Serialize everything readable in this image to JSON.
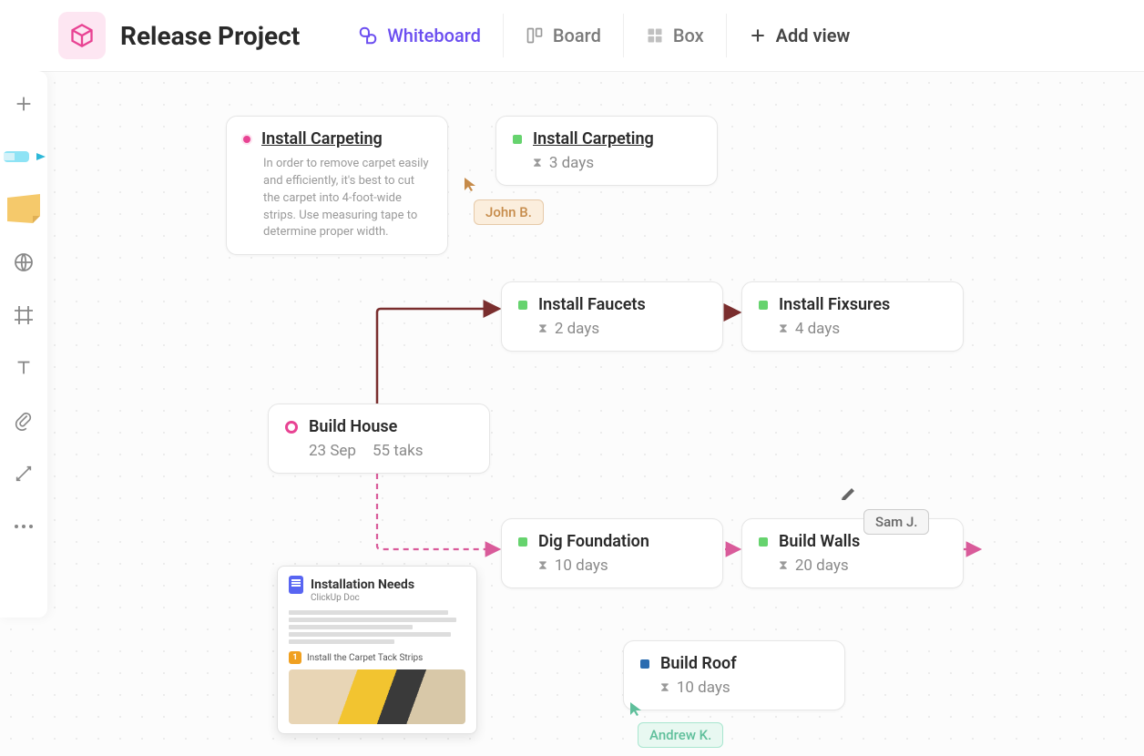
{
  "header": {
    "project_title": "Release Project",
    "tabs": {
      "whiteboard": "Whiteboard",
      "board": "Board",
      "box": "Box",
      "add_view": "Add view"
    }
  },
  "cards": {
    "install_carpeting_note": {
      "title": "Install Carpeting",
      "description": "In order to remove carpet easily and efficiently, it's best to cut the carpet into 4-foot-wide strips. Use measuring tape to determine proper width."
    },
    "install_carpeting_task": {
      "title": "Install Carpeting",
      "duration": "3 days"
    },
    "install_faucets": {
      "title": "Install Faucets",
      "duration": "2 days"
    },
    "install_fixtures": {
      "title": "Install Fixsures",
      "duration": "4 days"
    },
    "build_house": {
      "title": "Build House",
      "date": "23 Sep",
      "tasks": "55 taks"
    },
    "dig_foundation": {
      "title": "Dig Foundation",
      "duration": "10 days"
    },
    "build_walls": {
      "title": "Build Walls",
      "duration": "20 days"
    },
    "build_roof": {
      "title": "Build Roof",
      "duration": "10 days"
    }
  },
  "cursors": {
    "john": "John B.",
    "sam": "Sam J.",
    "andrew": "Andrew K."
  },
  "doc": {
    "title": "Installation Needs",
    "subtitle": "ClickUp Doc",
    "step_num": "1",
    "step_label": "Install the Carpet Tack Strips"
  },
  "colors": {
    "accent": "#6b4ef0",
    "pink": "#e84393",
    "green": "#66d36e",
    "blue": "#2b6cb0",
    "brown_connector": "#7a2e2e",
    "dashed_connector": "#d95b9a"
  }
}
